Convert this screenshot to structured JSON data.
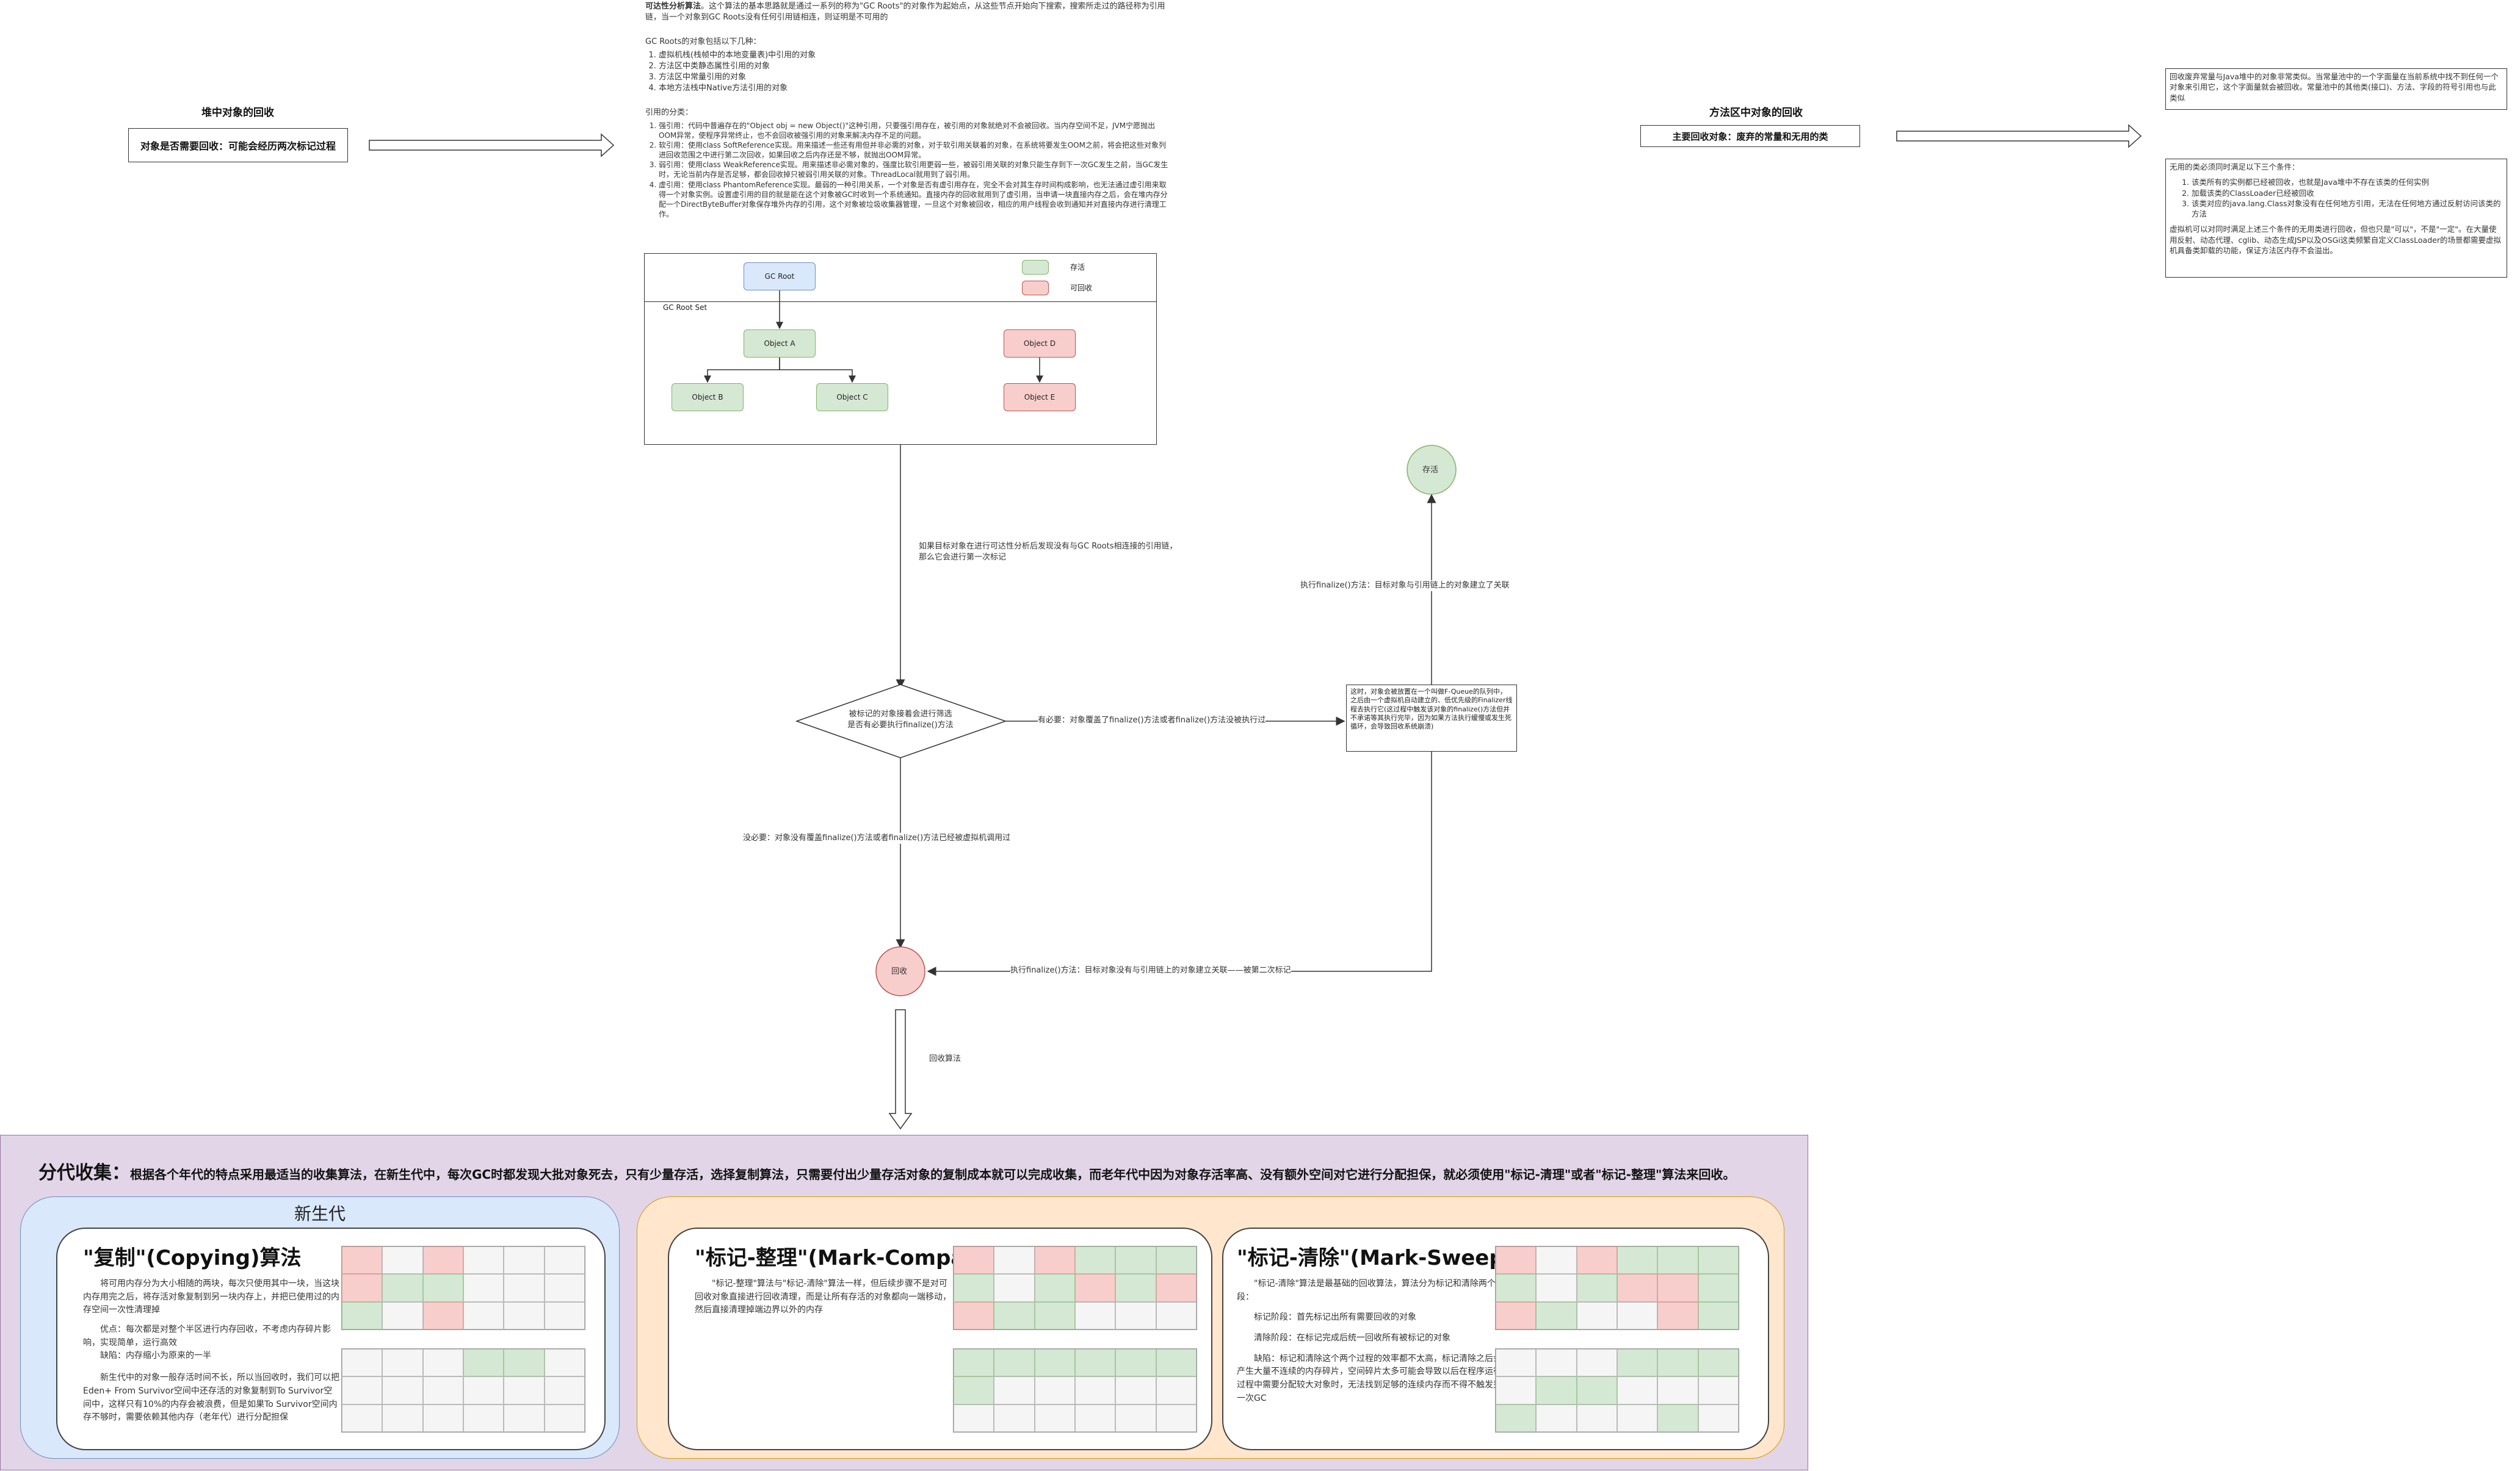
{
  "heap": {
    "title": "堆中对象的回收",
    "box": "对象是否需要回收：可能会经历两次标记过程"
  },
  "method_area": {
    "title": "方法区中对象的回收",
    "box": "主要回收对象：废弃的常量和无用的类",
    "note1": "回收废弃常量与Java堆中的对象非常类似。当常量池中的一个字面量在当前系统中找不到任何一个对象来引用它，这个字面量就会被回收。常量池中的其他类(接口)、方法、字段的符号引用也与此类似",
    "note2_title": "无用的类必须同时满足以下三个条件：",
    "note2_items": [
      "该类所有的实例都已经被回收，也就是Java堆中不存在该类的任何实例",
      "加载该类的ClassLoader已经被回收",
      "该类对应的java.lang.Class对象没有在任何地方引用，无法在任何地方通过反射访问该类的方法"
    ],
    "note2_tail": "虚拟机可以对同时满足上述三个条件的无用类进行回收，但也只是\"可以\"，不是\"一定\"。在大量使用反射、动态代理、cglib、动态生成JSP以及OSGi这类频繁自定义ClassLoader的场景都需要虚拟机具备类卸载的功能，保证方法区内存不会溢出。"
  },
  "reachability": {
    "intro_bold": "可达性分析算法",
    "intro": "。这个算法的基本思路就是通过一系列的称为\"GC Roots\"的对象作为起始点，从这些节点开始向下搜索，搜索所走过的路径称为引用链，当一个对象到GC Roots没有任何引用链相连，则证明是不可用的",
    "gcroots_title": "GC Roots的对象包括以下几种：",
    "gcroots": [
      "虚拟机栈(栈帧中的本地变量表)中引用的对象",
      "方法区中类静态属性引用的对象",
      "方法区中常量引用的对象",
      "本地方法栈中Native方法引用的对象"
    ],
    "ref_title": "引用的分类：",
    "refs": [
      "强引用：代码中普遍存在的\"Object obj = new Object()\"这种引用，只要强引用存在，被引用的对象就绝对不会被回收。当内存空间不足，JVM宁愿抛出OOM异常，使程序异常终止，也不会回收被强引用的对象来解决内存不足的问题。",
      "软引用：使用class SoftReference实现。用来描述一些还有用但并非必需的对象，对于软引用关联着的对象，在系统将要发生OOM之前，将会把这些对象列进回收范围之中进行第二次回收，如果回收之后内存还是不够，就抛出OOM异常。",
      "弱引用：使用class WeakReference实现。用来描述非必需对象的，强度比软引用更弱一些，被弱引用关联的对象只能生存到下一次GC发生之前，当GC发生时，无论当前内存是否足够，都会回收掉只被弱引用关联的对象。ThreadLocal就用到了弱引用。",
      "虚引用：使用class PhantomReference实现。最弱的一种引用关系，一个对象是否有虚引用存在，完全不会对其生存时间构成影响，也无法通过虚引用来取得一个对象实例。设置虚引用的目的就是能在这个对象被GC时收到一个系统通知。直接内存的回收就用到了虚引用，当申请一块直接内存之后，会在堆内存分配一个DirectByteBuffer对象保存堆外内存的引用，这个对象被垃圾收集器管理，一旦这个对象被回收，相应的用户线程会收到通知并对直接内存进行清理工作。"
    ]
  },
  "diagram": {
    "legend_alive": "存活",
    "legend_collectable": "可回收",
    "gc_root": "GC Root",
    "gc_root_set": "GC Root Set",
    "objects": [
      "Object A",
      "Object B",
      "Object C",
      "Object D",
      "Object E"
    ]
  },
  "flow": {
    "edge_first_mark": "如果目标对象在进行可达性分析后发现没有与GC Roots相连接的引用链，那么它会进行第一次标记",
    "decision": "被标记的对象接着会进行筛选\n是否有必要执行finalize()方法",
    "edge_yes": "有必要：对象覆盖了finalize()方法或者finalize()方法没被执行过",
    "fqueue_box": "这时，对象会被放置在一个叫做F-Queue的队列中，之后由一个虚拟机自动建立的、低优先级的Finalizer线程去执行它(这过程中触发该对象的finalize()方法但并不承诺等其执行完毕，因为如果方法执行缓慢或发生死循环，会导致回收系统崩溃)",
    "edge_survive": "执行finalize()方法：目标对象与引用链上的对象建立了关联",
    "survive": "存活",
    "edge_no": "没必要：对象没有覆盖finalize()方法或者finalize()方法已经被虚拟机调用过",
    "edge_second_mark": "执行finalize()方法：目标对象没有与引用链上的对象建立关联——被第二次标记",
    "recycle": "回收",
    "edge_algo": "回收算法"
  },
  "generational": {
    "title": "分代收集：",
    "desc": "根据各个年代的特点采用最适当的收集算法，在新生代中，每次GC时都发现大批对象死去，只有少量存活，选择复制算法，只需要付出少量存活对象的复制成本就可以完成收集，而老年代中因为对象存活率高、没有额外空间对它进行分配担保，就必须使用\"标记-清理\"或者\"标记-整理\"算法来回收。",
    "young_title": "新生代",
    "copying_title": "\"复制\"(Copying)算法",
    "copying_body": [
      "将可用内存分为大小相随的两块，每次只使用其中一块，当这块内存用完之后，将存活对象复制到另一块内存上，并把已使用过的内存空间一次性清理掉",
      "优点：每次都是对整个半区进行内存回收，不考虑内存碎片影响，实现简单，运行高效",
      "缺陷：内存缩小为原来的一半",
      "新生代中的对象一般存活时间不长，所以当回收时，我们可以把Eden+ From Survivor空间中还存活的对象复制到To Survivor空间中，这样只有10%的内存会被浪费，但是如果To Survivor空间内存不够时，需要依赖其他内存（老年代）进行分配担保"
    ],
    "compact_title": "\"标记-整理\"(Mark-Compact)",
    "compact_body": [
      "\"标记-整理\"算法与\"标记-清除\"算法一样，但后续步骤不是对可回收对象直接进行回收清理，而是让所有存活的对象都向一端移动，然后直接清理掉端边界以外的内存"
    ],
    "sweep_title": "\"标记-清除\"(Mark-Sweep)",
    "sweep_body": [
      "\"标记-清除\"算法是最基础的回收算法，算法分为标记和清除两个阶段：",
      "标记阶段：首先标记出所有需要回收的对象",
      "清除阶段：在标记完成后统一回收所有被标记的对象",
      "缺陷：标记和清除这个两个过程的效率都不太高，标记清除之后会产生大量不连续的内存碎片，空间碎片太多可能会导致以后在程序运行过程中需要分配较大对象时，无法找到足够的连续内存而不得不触发另一次GC"
    ],
    "grids": {
      "copying_top": [
        "r",
        "w",
        "r",
        "w",
        "w",
        "w",
        "r",
        "g",
        "g",
        "w",
        "w",
        "w",
        "g",
        "w",
        "r",
        "w",
        "w",
        "w"
      ],
      "copying_bottom": [
        "w",
        "w",
        "w",
        "g",
        "g",
        "w",
        "w",
        "w",
        "w",
        "w",
        "w",
        "w",
        "w",
        "w",
        "w",
        "w",
        "w",
        "w"
      ],
      "compact_top": [
        "r",
        "w",
        "r",
        "g",
        "g",
        "g",
        "g",
        "w",
        "g",
        "r",
        "g",
        "r",
        "r",
        "g",
        "g",
        "w",
        "w",
        "w"
      ],
      "compact_bottom": [
        "g",
        "g",
        "g",
        "g",
        "g",
        "g",
        "g",
        "w",
        "w",
        "w",
        "w",
        "w",
        "w",
        "w",
        "w",
        "w",
        "w",
        "w"
      ],
      "sweep_top": [
        "r",
        "w",
        "r",
        "g",
        "g",
        "g",
        "g",
        "w",
        "g",
        "r",
        "r",
        "g",
        "r",
        "g",
        "w",
        "w",
        "r",
        "g"
      ],
      "sweep_bottom": [
        "w",
        "w",
        "w",
        "g",
        "g",
        "g",
        "w",
        "g",
        "g",
        "w",
        "w",
        "w",
        "g",
        "w",
        "w",
        "w",
        "g",
        "w"
      ]
    }
  }
}
